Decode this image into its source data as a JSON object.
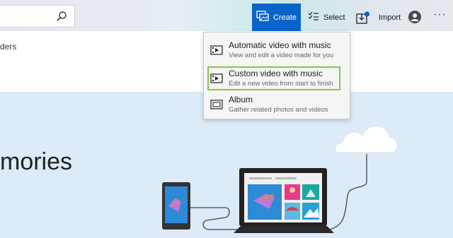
{
  "toolbar": {
    "create_label": "Create",
    "select_label": "Select",
    "import_label": "Import",
    "more_label": "···"
  },
  "content": {
    "folders_text": "ders",
    "hero_title": "mories"
  },
  "create_menu": {
    "items": [
      {
        "title": "Automatic video with music",
        "subtitle": "View and edit a video made for you",
        "icon": "video-music-icon"
      },
      {
        "title": "Custom video with music",
        "subtitle": "Edit a new video from start to finish",
        "icon": "video-music-icon",
        "selected": true
      },
      {
        "title": "Album",
        "subtitle": "Gather related photos and videos",
        "icon": "album-icon"
      }
    ]
  },
  "colors": {
    "accent": "#0a63c9",
    "selection_border": "#8bc34a",
    "hero_background": "#dcebf7"
  }
}
